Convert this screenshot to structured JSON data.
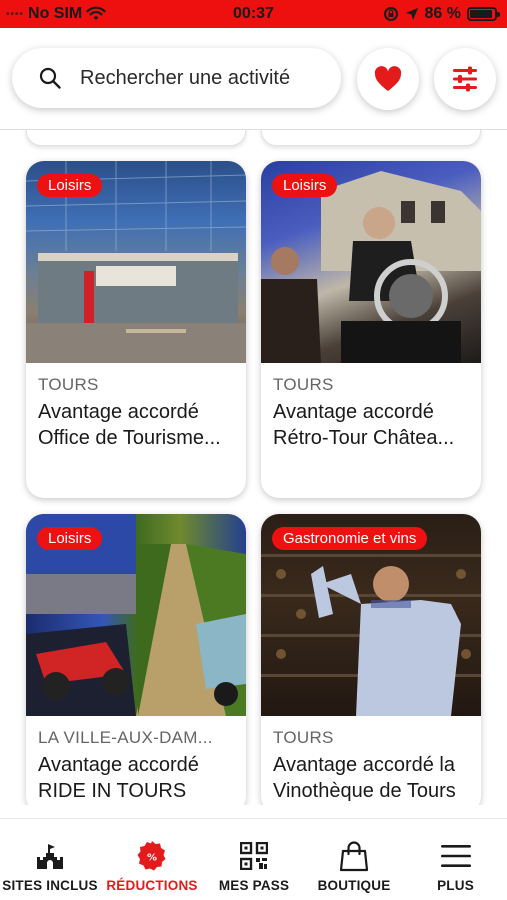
{
  "status_bar": {
    "carrier": "No SIM",
    "time": "00:37",
    "battery_text": "86 %",
    "battery_level": 0.86
  },
  "search": {
    "placeholder": "Rechercher une activité"
  },
  "cards": [
    {
      "category": "Loisirs",
      "place": "TOURS",
      "title_line1": "Avantage accordé",
      "title_line2": "Office de Tourisme..."
    },
    {
      "category": "Loisirs",
      "place": "TOURS",
      "title_line1": "Avantage accordé",
      "title_line2": "Rétro-Tour Châtea..."
    },
    {
      "category": "Loisirs",
      "place": "LA VILLE-AUX-DAM...",
      "title_line1": "Avantage accordé",
      "title_line2": "RIDE IN TOURS"
    },
    {
      "category": "Gastronomie et vins",
      "place": "TOURS",
      "title_line1": "Avantage accordé la",
      "title_line2": "Vinothèque de Tours"
    }
  ],
  "tabs": [
    {
      "label": "SITES INCLUS",
      "icon": "castle-icon",
      "active": false
    },
    {
      "label": "RÉDUCTIONS",
      "icon": "discount-badge-icon",
      "active": true
    },
    {
      "label": "MES PASS",
      "icon": "qr-code-icon",
      "active": false
    },
    {
      "label": "BOUTIQUE",
      "icon": "shopping-bag-icon",
      "active": false
    },
    {
      "label": "PLUS",
      "icon": "menu-icon",
      "active": false
    }
  ],
  "colors": {
    "accent": "#ee1111",
    "status_bar": "#ee0f0f"
  }
}
